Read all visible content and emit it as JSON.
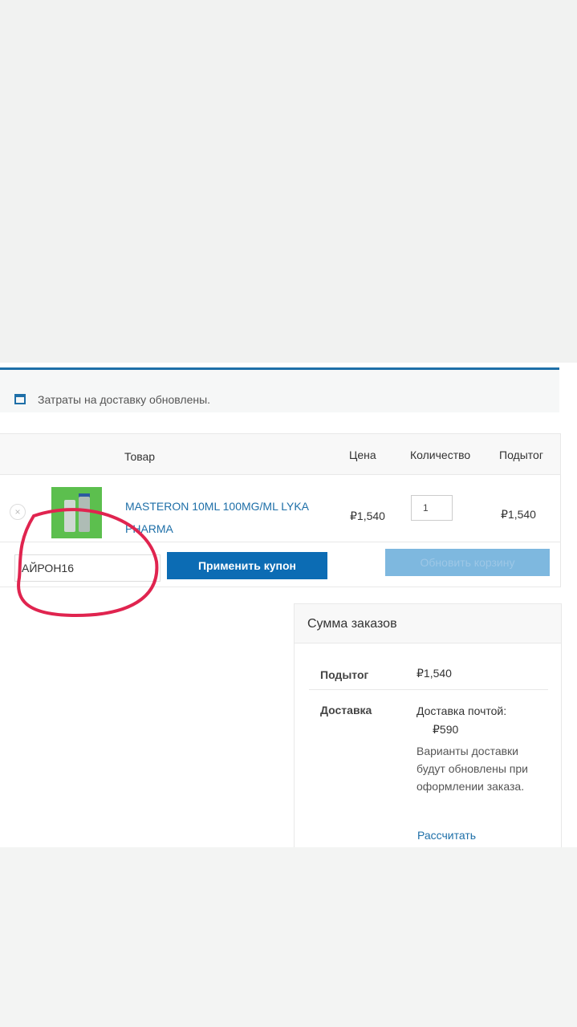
{
  "notice": {
    "text": "Затраты на доставку обновлены."
  },
  "cart": {
    "headers": {
      "product": "Товар",
      "price": "Цена",
      "quantity": "Количество",
      "subtotal": "Подытог"
    },
    "item": {
      "name": "MASTERON 10ML 100MG/ML LYKA PHARMA",
      "price": "₽1,540",
      "quantity": "1",
      "subtotal": "₽1,540"
    },
    "coupon": {
      "value": "АЙРОН16",
      "apply_label": "Применить купон"
    },
    "update_label": "Обновить корзину"
  },
  "totals": {
    "title": "Сумма заказов",
    "subtotal_label": "Подытог",
    "subtotal_value": "₽1,540",
    "shipping_label": "Доставка",
    "shipping_method": "Доставка почтой:",
    "shipping_cost": "₽590",
    "shipping_note": "Варианты доставки будут обновлены при оформлении заказа.",
    "calculate_link": "Рассчитать"
  },
  "colors": {
    "accent": "#0c6cb4",
    "link": "#1e6fa8",
    "annotation": "#e0244f",
    "product_image": "#5cbf4e"
  }
}
